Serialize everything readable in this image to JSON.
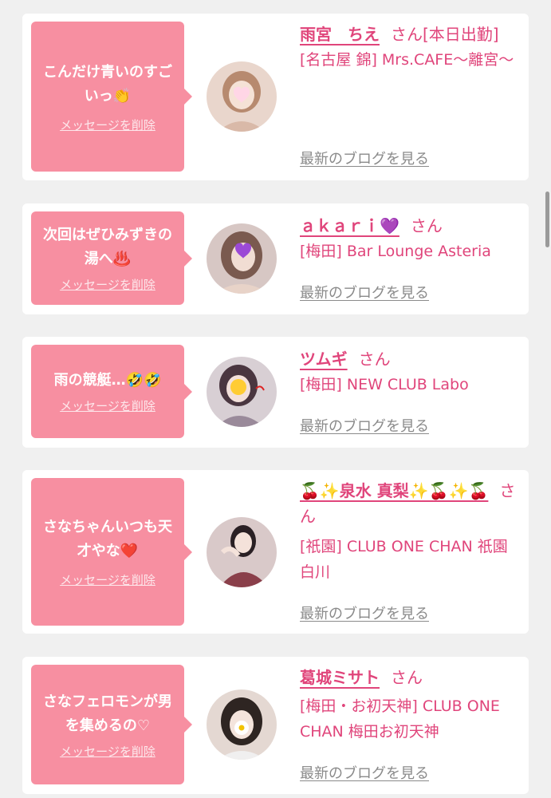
{
  "cards": [
    {
      "message": "こんだけ青いのすごいっ👏",
      "delete_label": "メッセージを削除",
      "name": "雨宮　ちえ",
      "honorific": "さん[本日出勤]",
      "shop": "[名古屋 錦] Mrs.CAFE〜離宮〜",
      "blog_label": "最新のブログを見る",
      "avatar_icon": "profile-photo-icon",
      "avatar_colors": [
        "#e9d6cc",
        "#a77c62"
      ]
    },
    {
      "message": "次回はぜひみずきの湯へ♨️",
      "delete_label": "メッセージを削除",
      "name": "ａｋａｒｉ💜",
      "honorific": "さん",
      "shop": "[梅田] Bar Lounge Asteria",
      "blog_label": "最新のブログを見る",
      "avatar_icon": "profile-photo-icon",
      "avatar_colors": [
        "#d7c7c4",
        "#6b4e46"
      ]
    },
    {
      "message": "雨の競艇…🤣🤣",
      "delete_label": "メッセージを削除",
      "name": "ツムギ",
      "honorific": "さん",
      "shop": "[梅田] NEW CLUB Labo",
      "blog_label": "最新のブログを見る",
      "avatar_icon": "profile-photo-icon",
      "avatar_colors": [
        "#d8cfd4",
        "#5a4450"
      ]
    },
    {
      "message": "さなちゃんいつも天才やな❤️",
      "delete_label": "メッセージを削除",
      "name": "🍒✨泉水 真梨✨🍒✨🍒",
      "honorific": "さん",
      "shop": "[祇園] CLUB ONE CHAN 祇園白川",
      "blog_label": "最新のブログを見る",
      "avatar_icon": "profile-photo-icon",
      "avatar_colors": [
        "#d9c9c9",
        "#8a3f4a"
      ]
    },
    {
      "message": "さなフェロモンが男を集めるの♡",
      "delete_label": "メッセージを削除",
      "name": "葛城ミサト",
      "honorific": "さん",
      "shop": "[梅田・お初天神] CLUB ONE CHAN 梅田お初天神",
      "blog_label": "最新のブログを見る",
      "avatar_icon": "profile-photo-icon",
      "avatar_colors": [
        "#e4d8d2",
        "#2e2522"
      ]
    }
  ],
  "colors": {
    "bubble": "#f78fa1",
    "accent": "#e0457b",
    "link_gray": "#8a8a8a"
  }
}
